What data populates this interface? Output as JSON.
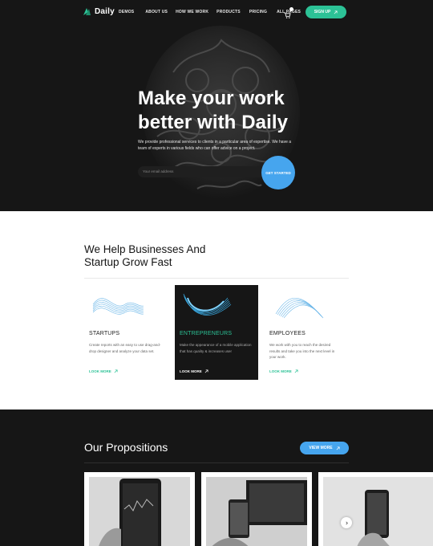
{
  "nav": {
    "logo": "Daily",
    "menu": [
      "DEMOS",
      "ABOUT US",
      "HOW WE WORK",
      "PRODUCTS",
      "PRICING",
      "ALL PAGES"
    ],
    "signup_label": "SIGN UP",
    "icons": [
      "daily-logo-icon",
      "cart-icon",
      "arrow-up-right-icon"
    ]
  },
  "hero": {
    "title_line1": "Make your work",
    "title_line2": "better with Daily",
    "description": "We provide professional services to clients in a particular area of expertise. We have a team of experts in various fields who can offer advice on a project.",
    "email_placeholder": "Your email address",
    "cta_label": "GET STARTED"
  },
  "help": {
    "title_line1": "We Help Businesses And",
    "title_line2": "Startup Grow Fast",
    "cards": [
      {
        "title": "STARTUPS",
        "text": "Create reports with an easy to use drag-and-drop designer and analyze your data set.",
        "link": "LOOK MORE",
        "style": "light"
      },
      {
        "title": "ENTREPRENEURS",
        "text": "Make the appearance of a mobile application that has quality & increases user",
        "link": "LOOK MORE",
        "style": "dark"
      },
      {
        "title": "EMPLOYEES",
        "text": "We work with you to reach the desired results and take you into the next level in your work.",
        "link": "LOOK MORE",
        "style": "light"
      }
    ]
  },
  "propositions": {
    "title": "Our Propositions",
    "view_more_label": "VIEW MORE"
  },
  "colors": {
    "accent_green": "#2cc296",
    "accent_blue": "#46a5ee",
    "dark_bg": "#161616"
  }
}
